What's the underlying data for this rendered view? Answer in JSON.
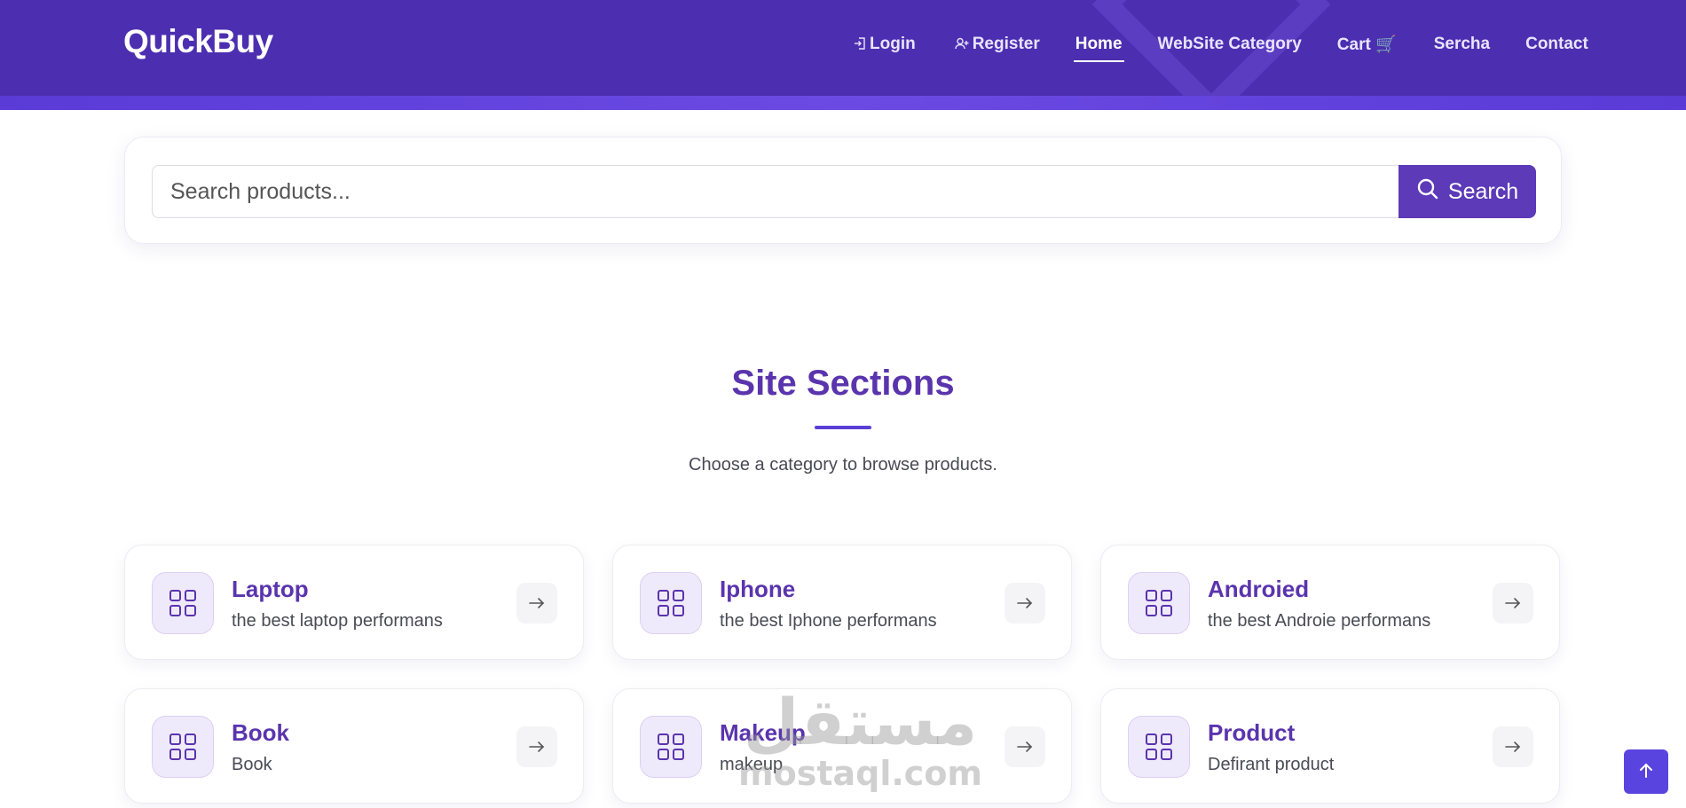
{
  "header": {
    "logo": "QuickBuy",
    "nav": [
      {
        "label": "Login",
        "icon": "login-icon"
      },
      {
        "label": "Register",
        "icon": "user-plus-icon"
      },
      {
        "label": "Home",
        "active": true
      },
      {
        "label": "WebSite Category"
      },
      {
        "label": "Cart 🛒"
      },
      {
        "label": "Sercha"
      },
      {
        "label": "Contact"
      }
    ]
  },
  "search": {
    "placeholder": "Search products...",
    "button_label": "Search"
  },
  "section": {
    "title": "Site Sections",
    "subtitle": "Choose a category to browse products."
  },
  "categories": [
    {
      "title": "Laptop",
      "desc": "the best laptop performans"
    },
    {
      "title": "Iphone",
      "desc": "the best Iphone performans"
    },
    {
      "title": "Androied",
      "desc": "the best Androie performans"
    },
    {
      "title": "Book",
      "desc": "Book"
    },
    {
      "title": "Makeup",
      "desc": "makeup"
    },
    {
      "title": "Product",
      "desc": "Defirant product"
    }
  ],
  "watermark": {
    "arabic": "مستقل",
    "latin": "mostaql.com"
  },
  "colors": {
    "header": "#4c2fb0",
    "accent": "#5a34ad",
    "button": "#5c3ab8",
    "scroll_top": "#5a44e0"
  }
}
